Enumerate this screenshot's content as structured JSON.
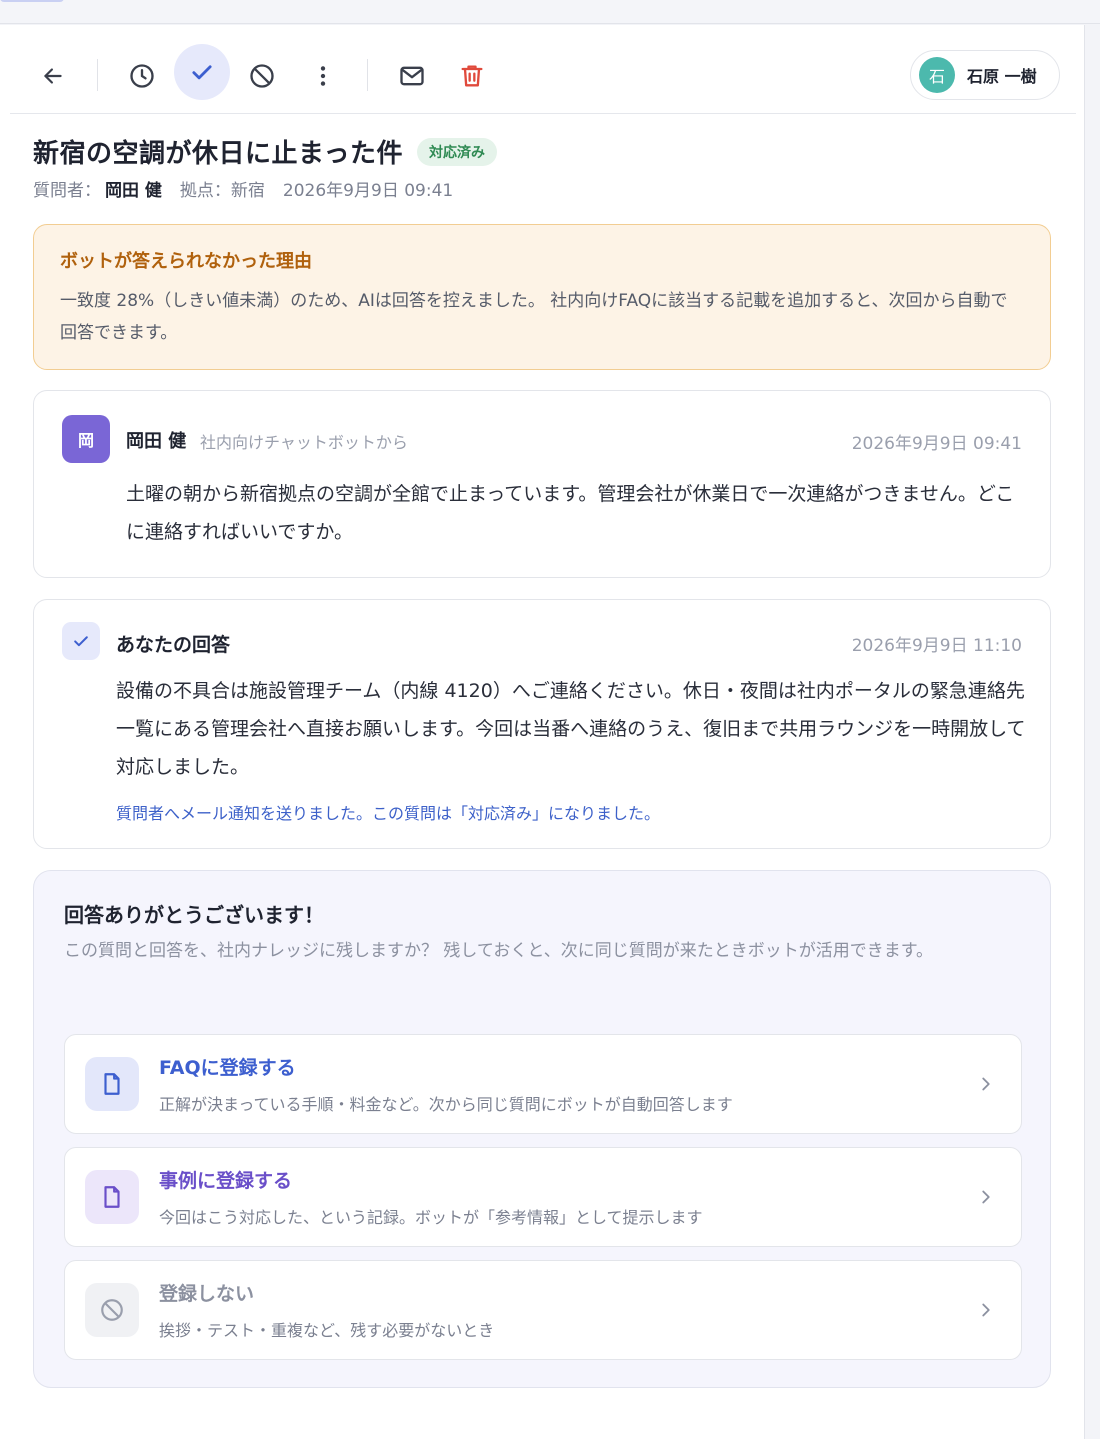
{
  "user": {
    "initial": "石",
    "name": "石原 一樹"
  },
  "header": {
    "title": "新宿の空調が休日に止まった件",
    "status": "対応済み",
    "asker_label": "質問者：",
    "asker": "岡田 健",
    "location": "拠点：新宿",
    "datetime": "2026年9月9日 09:41"
  },
  "warning": {
    "title": "ボットが答えられなかった理由",
    "text": "一致度 28%（しきい値未満）のため、AIは回答を控えました。 社内向けFAQに該当する記載を追加すると、次回から自動で回答できます。"
  },
  "question": {
    "avatar": "岡",
    "name": "岡田 健",
    "source": "社内向けチャットボットから",
    "time": "2026年9月9日 09:41",
    "body": "土曜の朝から新宿拠点の空調が全館で止まっています。管理会社が休業日で一次連絡がつきません。どこに連絡すればいいですか。"
  },
  "answer": {
    "title": "あなたの回答",
    "time": "2026年9月9日 11:10",
    "body": "設備の不具合は施設管理チーム（内線 4120）へご連絡ください。休日・夜間は社内ポータルの緊急連絡先一覧にある管理会社へ直接お願いします。今回は当番へ連絡のうえ、復旧まで共用ラウンジを一時開放して対応しました。",
    "note": "質問者へメール通知を送りました。この質問は「対応済み」になりました。"
  },
  "thanks": {
    "title": "回答ありがとうございます！",
    "text": "この質問と回答を、社内ナレッジに残しますか？ 残しておくと、次に同じ質問が来たときボットが活用できます。",
    "options": [
      {
        "title": "FAQに登録する",
        "desc": "正解が決まっている手順・料金など。次から同じ質問にボットが自動回答します",
        "color": "#3d5fcf"
      },
      {
        "title": "事例に登録する",
        "desc": "今回はこう対応した、という記録。ボットが「参考情報」として提示します",
        "color": "#6a4fc9"
      },
      {
        "title": "登録しない",
        "desc": "挨拶・テスト・重複など、残す必要がないとき",
        "color": "#8c91a0"
      }
    ]
  },
  "colors": {
    "accent": "#3d5fcf",
    "warning_bg": "#fdf3e6",
    "warning_title": "#b0610d",
    "success": "#2f8a53",
    "danger": "#e04a3c"
  },
  "icons": [
    "back-arrow-icon",
    "clock-icon",
    "check-icon",
    "block-icon",
    "more-vertical-icon",
    "mail-icon",
    "trash-icon",
    "document-icon",
    "chevron-right-icon"
  ]
}
